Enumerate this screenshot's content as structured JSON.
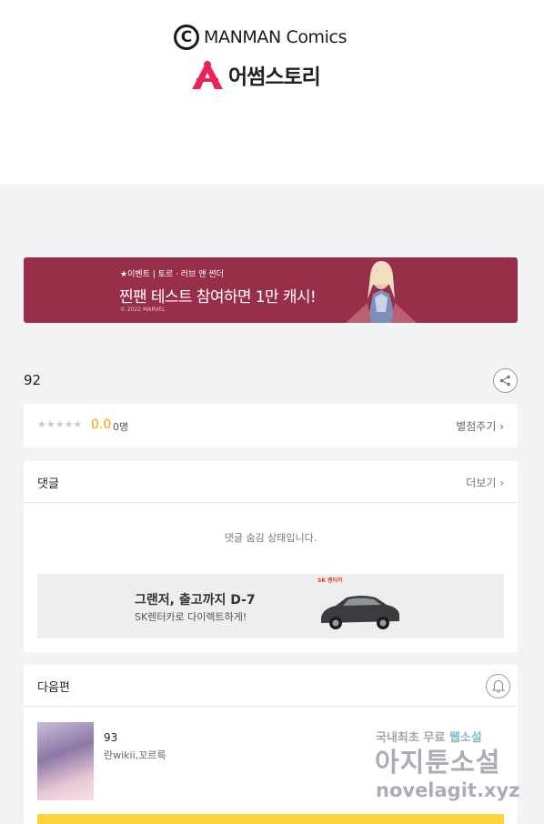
{
  "header": {
    "logo1_c": "C",
    "logo1_text": "MANMAN Comics",
    "logo2_text": "어썸스토리"
  },
  "banner": {
    "small_text": "★이벤트 | 토르 · 러브 앤 썬더",
    "main_text": "찐팬 테스트 참여하면 1만 캐시!",
    "copyright": "© 2022 MARVEL"
  },
  "episode": {
    "title": "92"
  },
  "rating": {
    "stars": "★★★★★",
    "score": "0.0",
    "count": "0명",
    "rate_label": "별점주기 ›"
  },
  "comments": {
    "label": "댓글",
    "more_label": "더보기 ›",
    "hidden_message": "댓글 숨김 상태입니다."
  },
  "ad": {
    "title": "그랜저, 출고까지 D-7",
    "subtitle": "SK렌터카로 다이렉트하게!",
    "sk_logo": "SK 렌터카"
  },
  "next": {
    "label": "다음편",
    "episode": "93",
    "authors": "란wikii,꼬르륵"
  },
  "watermark": {
    "line1a": "국내최초 무료",
    "line1b": "웹소설",
    "line2": "아지툰소설",
    "line3": "novelagit.xyz"
  },
  "colors": {
    "banner_bg": "#972f4b",
    "score": "#f5a100",
    "cta_yellow": "#fdd33a",
    "page_bg": "#f2f3f5"
  }
}
